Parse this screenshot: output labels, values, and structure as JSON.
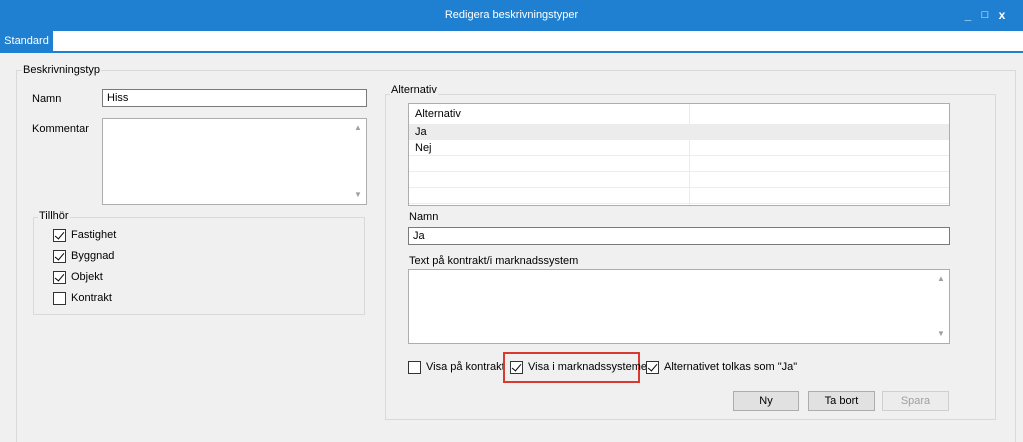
{
  "window": {
    "title": "Redigera beskrivningstyper",
    "minimize_glyph": "_",
    "maximize_glyph": "□",
    "close_glyph": "x"
  },
  "tabs": [
    {
      "label": "Standard",
      "selected": true
    }
  ],
  "left": {
    "group_title": "Beskrivningstyp",
    "name_label": "Namn",
    "name_value": "Hiss",
    "comment_label": "Kommentar",
    "comment_value": "",
    "belongs": {
      "title": "Tillhör",
      "items": [
        {
          "label": "Fastighet",
          "checked": true
        },
        {
          "label": "Byggnad",
          "checked": true
        },
        {
          "label": "Objekt",
          "checked": true
        },
        {
          "label": "Kontrakt",
          "checked": false
        }
      ]
    }
  },
  "right": {
    "group_title": "Alternativ",
    "list": {
      "header": "Alternativ",
      "rows": [
        "Ja",
        "Nej"
      ],
      "selected_index": 0
    },
    "name_label": "Namn",
    "name_value": "Ja",
    "text_label": "Text på kontrakt/i marknadssystem",
    "text_value": "",
    "options": [
      {
        "label": "Visa på kontrakt",
        "checked": false
      },
      {
        "label": "Visa i marknadssystemet",
        "checked": true,
        "highlighted": true
      },
      {
        "label": "Alternativet tolkas som \"Ja\"",
        "checked": true
      }
    ],
    "buttons": {
      "new": "Ny",
      "delete": "Ta bort",
      "save": "Spara"
    }
  },
  "colors": {
    "accent": "#1f80d1",
    "highlight": "#d9392f"
  }
}
